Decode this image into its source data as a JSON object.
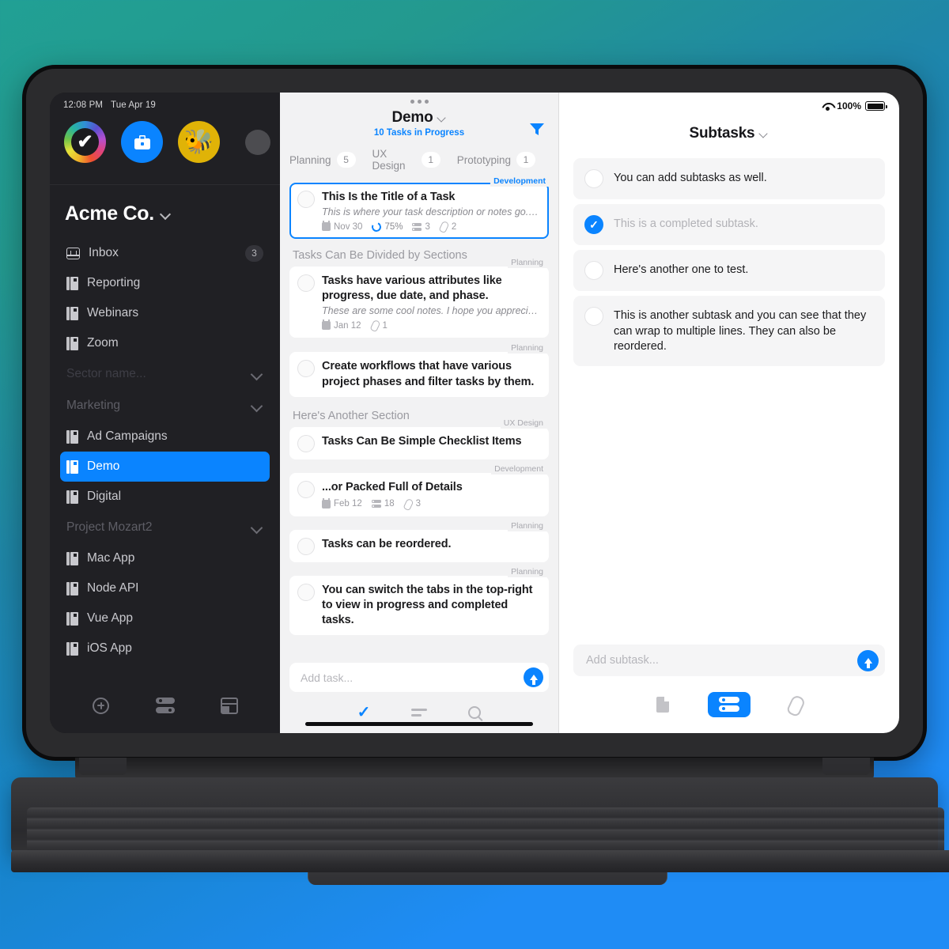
{
  "device": {
    "statusbar": {
      "time": "12:08 PM",
      "date": "Tue Apr 19"
    },
    "right_status": {
      "battery_pct": "100%",
      "wifi_icon": "wifi-icon",
      "battery_icon": "battery-icon"
    }
  },
  "sidebar": {
    "avatars": [
      {
        "name": "avatar-rainbow-check",
        "glyph": "✔"
      },
      {
        "name": "avatar-briefcase",
        "glyph": "💼"
      },
      {
        "name": "avatar-bee",
        "glyph": "🐝"
      },
      {
        "name": "avatar-more",
        "glyph": ""
      }
    ],
    "company": "Acme Co.",
    "items": [
      {
        "label": "Inbox",
        "icon": "inbox-icon",
        "badge": "3",
        "type": "item",
        "active": false
      },
      {
        "label": "Reporting",
        "icon": "project-icon",
        "type": "item",
        "active": false
      },
      {
        "label": "Webinars",
        "icon": "project-icon",
        "type": "item",
        "active": false
      },
      {
        "label": "Zoom",
        "icon": "project-icon",
        "type": "item",
        "active": false
      },
      {
        "label": "Sector name...",
        "type": "group",
        "dim": true
      },
      {
        "label": "Marketing",
        "type": "group",
        "dim": false
      },
      {
        "label": "Ad Campaigns",
        "icon": "project-icon",
        "type": "item",
        "active": false
      },
      {
        "label": "Demo",
        "icon": "project-icon",
        "type": "item",
        "active": true
      },
      {
        "label": "Digital",
        "icon": "project-icon",
        "type": "item",
        "active": false
      },
      {
        "label": "Project Mozart2",
        "type": "group",
        "dim": false
      },
      {
        "label": "Mac App",
        "icon": "project-icon",
        "type": "item",
        "active": false
      },
      {
        "label": "Node API",
        "icon": "project-icon",
        "type": "item",
        "active": false
      },
      {
        "label": "Vue App",
        "icon": "project-icon",
        "type": "item",
        "active": false
      },
      {
        "label": "iOS App",
        "icon": "project-icon",
        "type": "item",
        "active": false
      }
    ],
    "footer": [
      {
        "name": "add-button",
        "icon": "plus-circle-icon"
      },
      {
        "name": "filters-button",
        "icon": "sliders-icon"
      },
      {
        "name": "layout-button",
        "icon": "panel-icon"
      }
    ]
  },
  "middle": {
    "overflow_icon": "more-dots-icon",
    "title": "Demo",
    "subtitle": "10 Tasks in Progress",
    "filter_icon": "filter-icon",
    "tabs": [
      {
        "label": "Planning",
        "count": "5"
      },
      {
        "label": "UX Design",
        "count": "1"
      },
      {
        "label": "Prototyping",
        "count": "1"
      }
    ],
    "selected_task": {
      "phase": "Development",
      "title": "This Is the Title of a Task",
      "notes": "This is where your task description or notes go. T...",
      "date": "Nov 30",
      "progress": "75%",
      "subtasks": "3",
      "attachments": "2"
    },
    "sections": [
      {
        "title": "Tasks Can Be Divided by Sections",
        "tasks": [
          {
            "phase": "Planning",
            "title": "Tasks have various attributes like progress, due date, and phase.",
            "notes": "These are some cool notes. I hope you appreciate...",
            "date": "Jan 12",
            "attachments": "1"
          },
          {
            "phase": "Planning",
            "title": "Create workflows that have various project phases and filter tasks by them."
          }
        ]
      },
      {
        "title": "Here's Another Section",
        "tasks": [
          {
            "phase": "UX Design",
            "title": "Tasks Can Be Simple Checklist Items"
          },
          {
            "phase": "Development",
            "title": "...or Packed Full of Details",
            "date": "Feb 12",
            "subtasks": "18",
            "attachments": "3"
          },
          {
            "phase": "Planning",
            "title": "Tasks can be reordered."
          },
          {
            "phase": "Planning",
            "title": "You can switch the tabs in the top-right to view in progress and completed tasks."
          }
        ]
      }
    ],
    "add_placeholder": "Add task...",
    "send_icon": "send-up-icon",
    "footer": [
      {
        "name": "tab-tasks",
        "icon": "check-icon",
        "active": true
      },
      {
        "name": "tab-list",
        "icon": "lines-icon",
        "active": false
      },
      {
        "name": "tab-search",
        "icon": "search-icon",
        "active": false
      }
    ]
  },
  "right": {
    "title": "Subtasks",
    "subtasks": [
      {
        "text": "You can add subtasks as well.",
        "done": false
      },
      {
        "text": "This is a completed subtask.",
        "done": true
      },
      {
        "text": "Here's another one to test.",
        "done": false
      },
      {
        "text": "This is another subtask and you can see that they can wrap to multiple lines. They can also be reordered.",
        "done": false
      }
    ],
    "add_placeholder": "Add subtask...",
    "send_icon": "send-up-icon",
    "footer": [
      {
        "name": "tab-notes",
        "icon": "page-icon",
        "active": false
      },
      {
        "name": "tab-subtasks",
        "icon": "rows-icon",
        "active": true
      },
      {
        "name": "tab-attachments",
        "icon": "paperclip-icon",
        "active": false
      }
    ]
  },
  "colors": {
    "accent": "#0a84ff",
    "sidebar_bg": "#202024",
    "mid_bg": "#f2f2f3",
    "right_bg": "#ffffff"
  }
}
